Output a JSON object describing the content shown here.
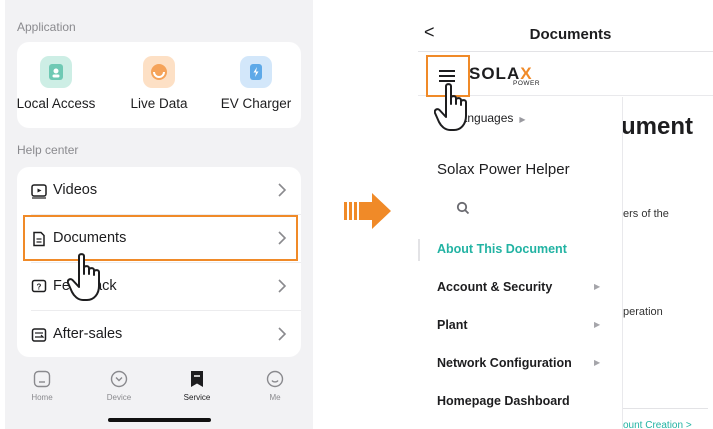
{
  "left": {
    "application_label": "Application",
    "apps": [
      {
        "label": "Local Access",
        "icon": "local-access-icon",
        "color": "#6fc9b4"
      },
      {
        "label": "Live Data",
        "icon": "live-data-icon",
        "color": "#f5a35a"
      },
      {
        "label": "EV Charger",
        "icon": "ev-charger-icon",
        "color": "#5ea9e8"
      }
    ],
    "help_center_label": "Help center",
    "help_items": [
      {
        "label": "Videos",
        "icon": "video-icon"
      },
      {
        "label": "Documents",
        "icon": "document-icon"
      },
      {
        "label": "Feedback",
        "icon": "feedback-icon"
      },
      {
        "label": "After-sales",
        "icon": "after-sales-icon"
      }
    ],
    "tabs": [
      {
        "label": "Home",
        "icon": "home-icon",
        "active": false
      },
      {
        "label": "Device",
        "icon": "device-icon",
        "active": false
      },
      {
        "label": "Service",
        "icon": "service-icon",
        "active": true
      },
      {
        "label": "Me",
        "icon": "me-icon",
        "active": false
      }
    ]
  },
  "arrow": {
    "color": "#f08a28"
  },
  "right": {
    "back_label": "<",
    "title": "Documents",
    "logo": {
      "main_before": "SOLA",
      "main_x": "X",
      "sub": "POWER"
    },
    "languages_label": "Languages",
    "helper_title": "Solax Power Helper",
    "doc_heading_fragment": "ument",
    "doc_fragment_1": "ers of the",
    "doc_fragment_2": "peration",
    "doc_fragment_3": "ount Creation >",
    "nav": [
      {
        "label": "About This Document",
        "active": true,
        "has_arrow": false
      },
      {
        "label": "Account & Security",
        "active": false,
        "has_arrow": true
      },
      {
        "label": "Plant",
        "active": false,
        "has_arrow": true
      },
      {
        "label": "Network Configuration",
        "active": false,
        "has_arrow": true
      },
      {
        "label": "Homepage Dashboard",
        "active": false,
        "has_arrow": false
      }
    ],
    "accent_color": "#22b3a3"
  },
  "highlight_color": "#f08a28"
}
